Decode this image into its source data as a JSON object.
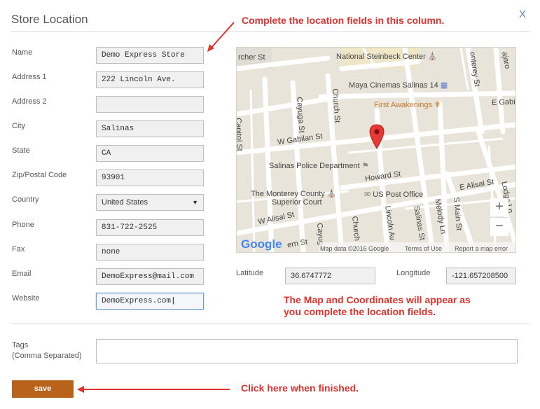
{
  "dialog": {
    "title": "Store Location",
    "close_label": "X"
  },
  "annotations": {
    "top": "Complete the location fields in this column.",
    "map_line1": "The Map and Coordinates will appear as",
    "map_line2": "you complete the location fields.",
    "save": "Click here when finished."
  },
  "form": {
    "fields": [
      {
        "label": "Name",
        "value": "Demo Express Store"
      },
      {
        "label": "Address 1",
        "value": "222 Lincoln Ave."
      },
      {
        "label": "Address 2",
        "value": ""
      },
      {
        "label": "City",
        "value": "Salinas"
      },
      {
        "label": "State",
        "value": "CA"
      },
      {
        "label": "Zip/Postal Code",
        "value": "93901"
      },
      {
        "label": "Country",
        "value": "United States"
      },
      {
        "label": "Phone",
        "value": "831-722-2525"
      },
      {
        "label": "Fax",
        "value": "none"
      },
      {
        "label": "Email",
        "value": "DemoExpress@mail.com"
      },
      {
        "label": "Website",
        "value": "DemoExpress.com"
      }
    ],
    "country_caret": "▼"
  },
  "map": {
    "streets": {
      "archer": "rcher St",
      "capitol": "Capitol St",
      "cayuga": "Cayuga St",
      "church": "Church St",
      "w_gabilan": "W Gabilan St",
      "howard": "Howard St",
      "w_alisal": "W Alisal St",
      "e_alisal": "E Alisal St",
      "lincoln": "Lincoln Av",
      "salinas": "Salinas St",
      "melody": "Melody Ln",
      "s_main": "S Main St",
      "monterey": "onterey St",
      "e_gabilan": "E Gabilar",
      "lodge": "Lodge Ln",
      "cayug2": "Cayug",
      "church2": "Church",
      "pajaro": "ajaro",
      "ern": "ern St"
    },
    "pois": {
      "steinbeck": "National Steinbeck Center",
      "maya": "Maya Cinemas Salinas 14",
      "first_awakenings": "First Awakenings",
      "police": "Salinas Police Department",
      "superior1": "The Monterey County",
      "superior2": "Superior Court",
      "post_office": "US Post Office"
    },
    "zoom_in": "+",
    "zoom_out": "−",
    "google_logo": "Google",
    "footer_data": "Map data ©2016 Google",
    "footer_terms": "Terms of Use",
    "footer_report": "Report a map error"
  },
  "coordinates": {
    "latitude_label": "Latitude",
    "latitude_value": "36.6747772",
    "longitude_label": "Longitude",
    "longitude_value": "-121.657208500"
  },
  "tags": {
    "label_line1": "Tags",
    "label_line2": "(Comma Separated)",
    "value": ""
  },
  "actions": {
    "save_label": "save"
  },
  "colors": {
    "annotation_red": "#e0312c",
    "save_button": "#b8621b",
    "map_pin": "#e53935"
  }
}
